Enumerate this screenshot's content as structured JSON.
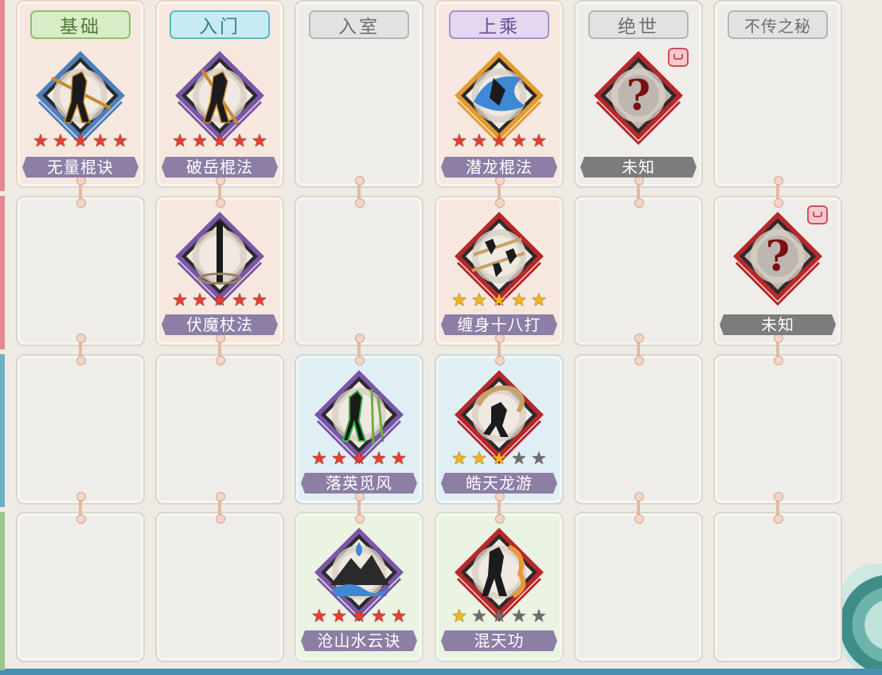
{
  "headers": [
    {
      "label": "基础",
      "bg": "#d9ecc8",
      "border": "#8fbf6d",
      "color": "#4e7b36"
    },
    {
      "label": "入门",
      "bg": "#c7ebf1",
      "border": "#5eb6c8",
      "color": "#2f7e92"
    },
    {
      "label": "入室",
      "bg": "#e2e2e2",
      "border": "#b5b5b5",
      "color": "#6e6e6e"
    },
    {
      "label": "上乘",
      "bg": "#e4d8f1",
      "border": "#a890cc",
      "color": "#6a4f97"
    },
    {
      "label": "绝世",
      "bg": "#e2e2e2",
      "border": "#b5b5b5",
      "color": "#6e6e6e"
    },
    {
      "label": "不传之秘",
      "bg": "#e2e2e2",
      "border": "#b5b5b5",
      "color": "#6e6e6e"
    }
  ],
  "left_rail_colors": [
    "#e08a90",
    "#e08a90",
    "#6fb0c4",
    "#9bc98a"
  ],
  "skills": [
    {
      "row": 0,
      "col": 0,
      "name": "无量棍诀",
      "stars": [
        "red",
        "red",
        "red",
        "red",
        "red"
      ],
      "frame": "blue",
      "art": "staff-fighter-icon",
      "bg": "base",
      "plate": "purple"
    },
    {
      "row": 0,
      "col": 1,
      "name": "破岳棍法",
      "stars": [
        "red",
        "red",
        "red",
        "red",
        "red"
      ],
      "frame": "purple",
      "art": "staff-swing-icon",
      "bg": "mid",
      "plate": "purple"
    },
    {
      "row": 0,
      "col": 3,
      "name": "潜龙棍法",
      "stars": [
        "red",
        "red",
        "red",
        "red",
        "red"
      ],
      "frame": "orange",
      "art": "water-dragon-icon",
      "bg": "mid",
      "plate": "purple"
    },
    {
      "row": 0,
      "col": 4,
      "name": "未知",
      "stars": [],
      "frame": "red",
      "art": "question-mark-icon",
      "bg": "none",
      "plate": "gray",
      "locked": true
    },
    {
      "row": 1,
      "col": 1,
      "name": "伏魔杖法",
      "stars": [
        "red",
        "red",
        "red",
        "red",
        "red"
      ],
      "frame": "purple",
      "art": "whirlwind-staff-icon",
      "bg": "mid",
      "plate": "purple"
    },
    {
      "row": 1,
      "col": 3,
      "name": "缠身十八打",
      "stars": [
        "gold",
        "gold",
        "gold",
        "gold",
        "gold"
      ],
      "frame": "red",
      "art": "multi-fighter-icon",
      "bg": "mid",
      "plate": "purple"
    },
    {
      "row": 1,
      "col": 5,
      "name": "未知",
      "stars": [],
      "frame": "red",
      "art": "question-mark-icon",
      "bg": "none",
      "plate": "gray",
      "locked": true
    },
    {
      "row": 2,
      "col": 2,
      "name": "落英觅风",
      "stars": [
        "red",
        "red",
        "red",
        "red",
        "red"
      ],
      "frame": "purple",
      "art": "bamboo-fighter-icon",
      "bg": "blue",
      "plate": "purple"
    },
    {
      "row": 2,
      "col": 3,
      "name": "皓天龙游",
      "stars": [
        "gold",
        "gold",
        "gold",
        "empty",
        "empty"
      ],
      "frame": "red",
      "art": "dragon-fighter-icon",
      "bg": "blue",
      "plate": "purple"
    },
    {
      "row": 3,
      "col": 2,
      "name": "沧山水云诀",
      "stars": [
        "red",
        "red",
        "red",
        "red",
        "red"
      ],
      "frame": "purple",
      "art": "water-mountain-icon",
      "bg": "green",
      "plate": "purple"
    },
    {
      "row": 3,
      "col": 3,
      "name": "混天功",
      "stars": [
        "gold",
        "empty",
        "empty",
        "empty",
        "empty"
      ],
      "frame": "red",
      "art": "flame-fighter-icon",
      "bg": "green",
      "plate": "purple"
    }
  ],
  "colors": {
    "frame_blue": "#4f7fbf",
    "frame_purple": "#7b56a8",
    "frame_orange": "#e49a2e",
    "frame_red": "#b8272a",
    "plate_purple": "#8c7ea5",
    "plate_gray": "#7c7c7c"
  }
}
